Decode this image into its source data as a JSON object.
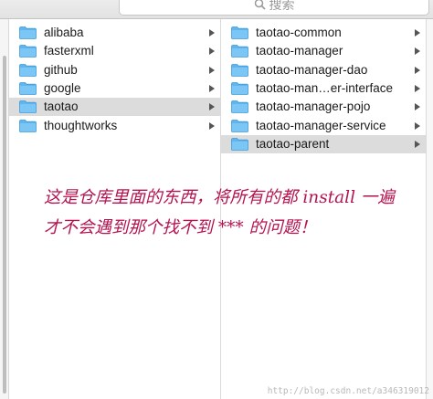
{
  "search": {
    "placeholder": "搜索",
    "icon": "search-icon"
  },
  "column_left": {
    "items": [
      {
        "label": "alibaba",
        "selected": false,
        "icon": "folder-icon"
      },
      {
        "label": "fasterxml",
        "selected": false,
        "icon": "folder-icon"
      },
      {
        "label": "github",
        "selected": false,
        "icon": "folder-icon"
      },
      {
        "label": "google",
        "selected": false,
        "icon": "folder-icon"
      },
      {
        "label": "taotao",
        "selected": true,
        "icon": "folder-icon"
      },
      {
        "label": "thoughtworks",
        "selected": false,
        "icon": "folder-icon"
      }
    ]
  },
  "column_right": {
    "items": [
      {
        "label": "taotao-common",
        "selected": false,
        "icon": "folder-icon"
      },
      {
        "label": "taotao-manager",
        "selected": false,
        "icon": "folder-icon"
      },
      {
        "label": "taotao-manager-dao",
        "selected": false,
        "icon": "folder-icon"
      },
      {
        "label": "taotao-man…er-interface",
        "selected": false,
        "icon": "folder-icon"
      },
      {
        "label": "taotao-manager-pojo",
        "selected": false,
        "icon": "folder-icon"
      },
      {
        "label": "taotao-manager-service",
        "selected": false,
        "icon": "folder-icon"
      },
      {
        "label": "taotao-parent",
        "selected": true,
        "icon": "folder-icon"
      }
    ]
  },
  "annotation": {
    "line1": "这是仓库里面的东西，将所有的都 install 一遍",
    "line2": "才不会遇到那个找不到 *** 的问题！",
    "color": "#b5134f"
  },
  "watermark": "http://blog.csdn.net/a346319012",
  "colors": {
    "folder": "#5fb6ee",
    "selection": "#dcdcdc"
  }
}
